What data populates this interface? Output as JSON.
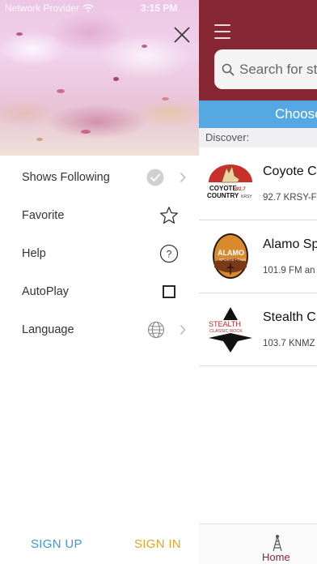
{
  "status_bar": {
    "carrier": "Network Provider",
    "time": "3:15 PM"
  },
  "drawer": {
    "close_icon": "close-icon",
    "menu_items": [
      {
        "label": "Shows Following",
        "icon": "check-circle-icon",
        "chevron": true
      },
      {
        "label": "Favorite",
        "icon": "star-outline-icon",
        "chevron": false
      },
      {
        "label": "Help",
        "icon": "help-circle-icon",
        "chevron": false
      },
      {
        "label": "AutoPlay",
        "icon": "checkbox-icon",
        "chevron": false
      },
      {
        "label": "Language",
        "icon": "globe-icon",
        "chevron": true
      }
    ],
    "sign_up": "SIGN UP",
    "sign_in": "SIGN IN"
  },
  "main": {
    "search_placeholder": "Search for sta",
    "choose_label": "Choose",
    "discover_label": "Discover:",
    "stations": [
      {
        "name": "Coyote C",
        "subtitle": "92.7 KRSY-F",
        "logo_text": "COYOTE 92.7 COUNTRY KRSY"
      },
      {
        "name": "Alamo Sp",
        "subtitle": "101.9 FM an",
        "logo_text": "ALAMO SPORTS TALK"
      },
      {
        "name": "Stealth C",
        "subtitle": "103.7 KNMZ",
        "logo_text": "STEALTH CLASSIC ROCK"
      }
    ],
    "tab_home": "Home"
  },
  "colors": {
    "header": "#862633",
    "choose_bar": "#55a8e2",
    "sign_up": "#3d98d6",
    "sign_in": "#e7a425"
  }
}
